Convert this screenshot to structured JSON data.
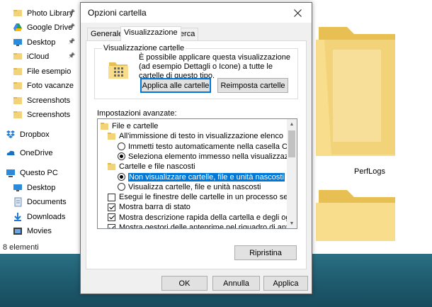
{
  "explorer": {
    "nav_items": [
      {
        "label": "Photo Library",
        "icon": "photo-library-icon",
        "pinned": true
      },
      {
        "label": "Google Drive",
        "icon": "google-drive-icon",
        "pinned": true
      },
      {
        "label": "Desktop",
        "icon": "desktop-icon",
        "pinned": true
      },
      {
        "label": "iCloud",
        "icon": "icloud-icon",
        "pinned": true
      },
      {
        "label": "File esempio",
        "icon": "folder-icon",
        "pinned": false
      },
      {
        "label": "Foto vacanze",
        "icon": "folder-icon",
        "pinned": false
      },
      {
        "label": "Screenshots",
        "icon": "folder-icon",
        "pinned": false
      },
      {
        "label": "Screenshots",
        "icon": "folder-icon",
        "pinned": false
      },
      {
        "label": "Dropbox",
        "icon": "dropbox-icon",
        "pinned": false
      },
      {
        "label": "OneDrive",
        "icon": "onedrive-icon",
        "pinned": false
      },
      {
        "label": "Questo PC",
        "icon": "this-pc-icon",
        "pinned": false
      },
      {
        "label": "Desktop",
        "icon": "desktop-icon",
        "pinned": false
      },
      {
        "label": "Documents",
        "icon": "documents-icon",
        "pinned": false
      },
      {
        "label": "Downloads",
        "icon": "downloads-icon",
        "pinned": false
      },
      {
        "label": "Movies",
        "icon": "movies-icon",
        "pinned": false
      }
    ],
    "status": "8 elementi",
    "folder_label": "PerfLogs"
  },
  "dialog": {
    "title": "Opzioni cartella",
    "tabs": [
      "Generale",
      "Visualizzazione",
      "Cerca"
    ],
    "active_tab": "Visualizzazione",
    "group_title": "Visualizzazione cartelle",
    "group_desc": "È possibile applicare questa visualizzazione (ad esempio Dettagli o Icone) a tutte le cartelle di questo tipo.",
    "apply_folders_label": "Applica alle cartelle",
    "reset_folders_label": "Reimposta cartelle",
    "advanced_label": "Impostazioni avanzate:",
    "tree": [
      {
        "type": "folder",
        "label": "File e cartelle",
        "indent": 0
      },
      {
        "type": "folder",
        "label": "All'immissione di testo in visualizzazione elenco",
        "indent": 1
      },
      {
        "type": "radio",
        "label": "Immetti testo automaticamente nella casella Cerca",
        "indent": 2,
        "checked": false
      },
      {
        "type": "radio",
        "label": "Seleziona elemento immesso nella visualizzazione",
        "indent": 2,
        "checked": true
      },
      {
        "type": "folder",
        "label": "Cartelle e file nascosti",
        "indent": 1
      },
      {
        "type": "radio",
        "label": "Non visualizzare cartelle, file e unità nascosti",
        "indent": 2,
        "checked": true,
        "selected": true
      },
      {
        "type": "radio",
        "label": "Visualizza cartelle, file e unità nascosti",
        "indent": 2,
        "checked": false
      },
      {
        "type": "check",
        "label": "Esegui le finestre delle cartelle in un processo separato",
        "indent": 1,
        "checked": false
      },
      {
        "type": "check",
        "label": "Mostra barra di stato",
        "indent": 1,
        "checked": true
      },
      {
        "type": "check",
        "label": "Mostra descrizione rapida della cartella e degli oggetti del",
        "indent": 1,
        "checked": true
      },
      {
        "type": "check",
        "label": "Mostra gestori delle anteprime nel riquadro di anteprima",
        "indent": 1,
        "checked": true
      }
    ],
    "restore_label": "Ripristina",
    "ok_label": "OK",
    "cancel_label": "Annulla",
    "apply_label": "Applica",
    "close_icon": "close-icon"
  },
  "colors": {
    "selection": "#0078d7",
    "folder_yellow": "#f3d37a",
    "taskbar": "#1e5a6e"
  }
}
